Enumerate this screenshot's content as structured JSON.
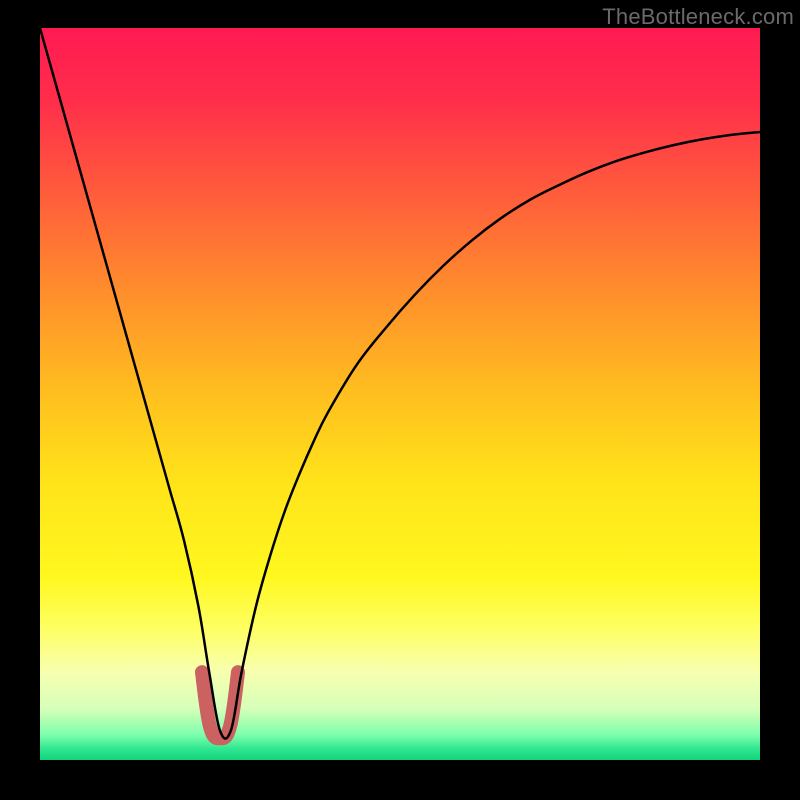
{
  "watermark": "TheBottleneck.com",
  "gradient_stops": [
    {
      "offset": 0.0,
      "color": "#ff1a52"
    },
    {
      "offset": 0.1,
      "color": "#ff2e4b"
    },
    {
      "offset": 0.22,
      "color": "#ff5a3c"
    },
    {
      "offset": 0.35,
      "color": "#ff8a2d"
    },
    {
      "offset": 0.5,
      "color": "#ffbf1f"
    },
    {
      "offset": 0.62,
      "color": "#ffe31a"
    },
    {
      "offset": 0.75,
      "color": "#fff81f"
    },
    {
      "offset": 0.82,
      "color": "#feff62"
    },
    {
      "offset": 0.88,
      "color": "#f7ffb0"
    },
    {
      "offset": 0.93,
      "color": "#d6ffb9"
    },
    {
      "offset": 0.965,
      "color": "#7fffad"
    },
    {
      "offset": 0.985,
      "color": "#30e690"
    },
    {
      "offset": 1.0,
      "color": "#12d37e"
    }
  ],
  "chart_data": {
    "type": "line",
    "title": "",
    "xlabel": "",
    "ylabel": "",
    "xlim": [
      0,
      100
    ],
    "ylim": [
      0,
      100
    ],
    "series": [
      {
        "name": "bottleneck-curve",
        "x": [
          0,
          2,
          4,
          6,
          8,
          10,
          12,
          14,
          16,
          18,
          20,
          22,
          23.5,
          25,
          26.5,
          28,
          30,
          32,
          34,
          36,
          38,
          40,
          44,
          48,
          52,
          56,
          60,
          64,
          68,
          72,
          76,
          80,
          84,
          88,
          92,
          96,
          100
        ],
        "values": [
          100,
          93,
          86,
          79,
          72,
          65,
          58,
          51,
          44,
          37,
          30,
          21,
          12,
          4,
          4,
          12,
          21,
          28,
          34,
          39,
          43.5,
          47.5,
          54,
          59,
          63.5,
          67.5,
          71,
          74,
          76.5,
          78.5,
          80.3,
          81.8,
          83,
          84,
          84.8,
          85.4,
          85.8
        ]
      },
      {
        "name": "optimal-marker",
        "x": [
          22.5,
          23.0,
          23.5,
          24.0,
          24.5,
          25.0,
          25.5,
          26.0,
          26.5,
          27.0,
          27.5
        ],
        "values": [
          12.0,
          8.0,
          5.0,
          3.5,
          3.0,
          3.0,
          3.0,
          3.5,
          5.0,
          8.0,
          12.0
        ]
      }
    ],
    "optimal_x": 25,
    "annotations": []
  },
  "styles": {
    "curve_color": "#000000",
    "curve_width": 2.5,
    "marker_color": "#cc6161",
    "marker_width": 14
  }
}
